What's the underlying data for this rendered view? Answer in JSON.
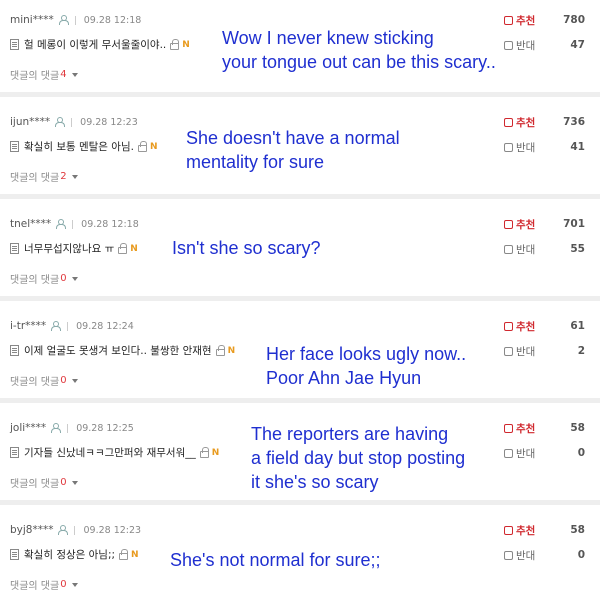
{
  "vote": {
    "up_label": "추천",
    "down_label": "반대"
  },
  "replies_label": "댓글의 댓글",
  "comments": [
    {
      "user": "mini****",
      "time": "09.28 12:18",
      "text": "헐 메롱이 이렇게 무서울줄이야..",
      "new": "N",
      "replies": "4",
      "up": "780",
      "down": "47",
      "translation": [
        "Wow I never knew sticking",
        "your tongue out can be this scary.."
      ]
    },
    {
      "user": "ijun****",
      "time": "09.28 12:23",
      "text": "확실히 보통 멘탈은 아님.",
      "new": "N",
      "replies": "2",
      "up": "736",
      "down": "41",
      "translation": [
        "She doesn't have a normal",
        "mentality for sure"
      ]
    },
    {
      "user": "tnel****",
      "time": "09.28 12:18",
      "text": "너무무섭지않나요 ㅠ",
      "new": "N",
      "replies": "0",
      "up": "701",
      "down": "55",
      "translation": [
        "Isn't she so scary?"
      ]
    },
    {
      "user": "i-tr****",
      "time": "09.28 12:24",
      "text": "이제 얼굴도 못생겨 보인다.. 불쌍한 안재현",
      "new": "N",
      "replies": "0",
      "up": "61",
      "down": "2",
      "translation": [
        "Her face looks ugly now..",
        "Poor Ahn Jae Hyun"
      ]
    },
    {
      "user": "joli****",
      "time": "09.28 12:25",
      "text": "기자들 신났네ㅋㅋ그만퍼와 재무서워__",
      "new": "N",
      "replies": "0",
      "up": "58",
      "down": "0",
      "translation": [
        "The reporters are having",
        "a field day but stop posting",
        "it she's so scary"
      ]
    },
    {
      "user": "byj8****",
      "time": "09.28 12:23",
      "text": "확실히 정상은 아님;;",
      "new": "N",
      "replies": "0",
      "up": "58",
      "down": "0",
      "translation": [
        "She's not normal for sure;;"
      ]
    }
  ]
}
